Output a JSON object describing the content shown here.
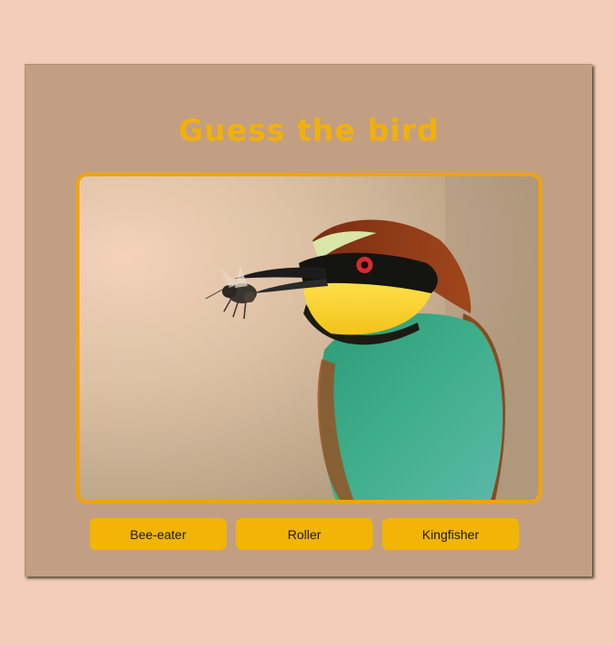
{
  "game": {
    "title": "Guess the bird",
    "image_subject": "European bee-eater holding a bee in its beak",
    "choices": [
      {
        "label": "Bee-eater"
      },
      {
        "label": "Roller"
      },
      {
        "label": "Kingfisher"
      }
    ]
  },
  "colors": {
    "page_background": "#f3cdb8",
    "card_background": "#c29f82",
    "accent": "#f1b00a",
    "frame_border": "#f0a30b"
  }
}
